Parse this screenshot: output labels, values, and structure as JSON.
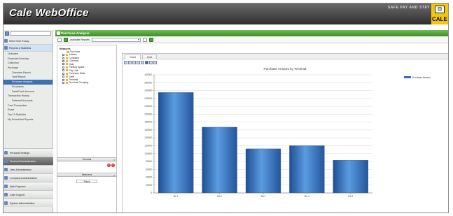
{
  "header": {
    "app_title": "Cale WebOffice",
    "tagline": "SAFE PAY AND STAY",
    "brand_short": "CALE"
  },
  "sidebar": {
    "items": [
      {
        "label": "Web2 Nice Essay"
      },
      {
        "label": "Reports & Statistics"
      }
    ],
    "report_items": [
      {
        "label": "Overview",
        "level": 1
      },
      {
        "label": "Financial Overview",
        "level": 1
      },
      {
        "label": "Collection",
        "level": 1
      },
      {
        "label": "Purchase",
        "level": 1
      },
      {
        "label": "Overview Report",
        "level": 2
      },
      {
        "label": "Tariff Report",
        "level": 2
      },
      {
        "label": "Purchase Analysis",
        "level": 2
      },
      {
        "label": "Purchases",
        "level": 2
      },
      {
        "label": "Debit/Cash Account",
        "level": 2
      },
      {
        "label": "Transaction History",
        "level": 1
      },
      {
        "label": "Deferred Accounts",
        "level": 2
      },
      {
        "label": "Card Transaction",
        "level": 1
      },
      {
        "label": "Event",
        "level": 1
      },
      {
        "label": "Top 10 Statistics",
        "level": 1
      },
      {
        "label": "My Scheduled Reports",
        "level": 1
      }
    ],
    "bottom_items": [
      {
        "label": "Personal Settings"
      },
      {
        "label": "Terminal Administration"
      },
      {
        "label": "User Administration"
      },
      {
        "label": "Company Administration"
      },
      {
        "label": "Web Payment"
      },
      {
        "label": "Cale Support"
      },
      {
        "label": "System Administration"
      }
    ]
  },
  "main": {
    "title": "Purchase Analysis",
    "available_reports_label": "Available Reports",
    "tree_root": "Measures",
    "tree_first_child": "Purchase",
    "tree_items": [
      "Articles",
      "Company",
      "Currency",
      "Date",
      "Parking Space",
      "Pay Unit",
      "Purchase State",
      "Tariff",
      "Terminal",
      "Terminal Grouping"
    ],
    "terminal_label": "Terminal",
    "measures_label": "Measures",
    "measures_value": "Prices",
    "tabs": [
      {
        "label": "Chart"
      },
      {
        "label": "Grid"
      }
    ]
  },
  "colors": {
    "header_bg": "#3e3e3e",
    "title_bar": "#4e9f35",
    "bar_fill": "#3a78c2",
    "brand": "#f3c60c"
  },
  "chart_data": {
    "type": "bar",
    "title": "Purchase Amount by Terminal",
    "categories": [
      "BA 1",
      "BA 2",
      "BA 3",
      "BA 4",
      "BA 5"
    ],
    "series": [
      {
        "name": "Purchase Amount",
        "values": [
          255000,
          167000,
          112000,
          120000,
          83000
        ]
      }
    ],
    "y_ticks": [
      0,
      20000,
      40000,
      60000,
      80000,
      100000,
      120000,
      140000,
      160000,
      180000,
      200000,
      220000,
      240000,
      260000,
      280000,
      300000
    ],
    "ylim": [
      0,
      300000
    ],
    "legend_position": "top-right",
    "grid": true
  }
}
